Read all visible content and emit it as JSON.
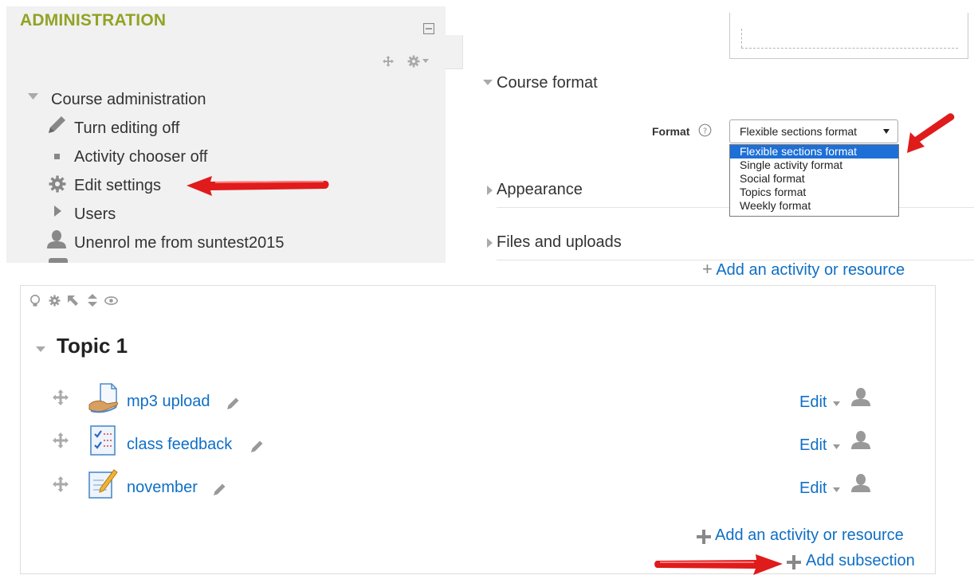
{
  "admin": {
    "title": "ADMINISTRATION",
    "course_admin": "Course administration",
    "items": [
      {
        "label": "Turn editing off",
        "icon": "pencil-icon"
      },
      {
        "label": "Activity chooser off",
        "icon": "square-bullet-icon"
      },
      {
        "label": "Edit settings",
        "icon": "gear-icon"
      },
      {
        "label": "Users",
        "icon": "triangle-right-icon"
      },
      {
        "label": "Unenrol me from suntest2015",
        "icon": "user-icon"
      }
    ]
  },
  "format_panel": {
    "course_format": "Course format",
    "format_label": "Format",
    "selected": "Flexible sections format",
    "options": [
      "Flexible sections format",
      "Single activity format",
      "Social format",
      "Topics format",
      "Weekly format"
    ],
    "appearance": "Appearance",
    "files_uploads": "Files and uploads"
  },
  "topic": {
    "add_activity_top": "Add an activity or resource",
    "title": "Topic 1",
    "activities": [
      {
        "name": "mp3 upload",
        "edit": "Edit"
      },
      {
        "name": "class feedback",
        "edit": "Edit"
      },
      {
        "name": "november",
        "edit": "Edit"
      }
    ],
    "add_activity": "Add an activity or resource",
    "add_subsection": "Add subsection"
  },
  "colors": {
    "accent_green": "#92a324",
    "link_blue": "#0f6fc5",
    "arrow_red": "#e01b1b",
    "option_highlight": "#1e6fd6"
  }
}
